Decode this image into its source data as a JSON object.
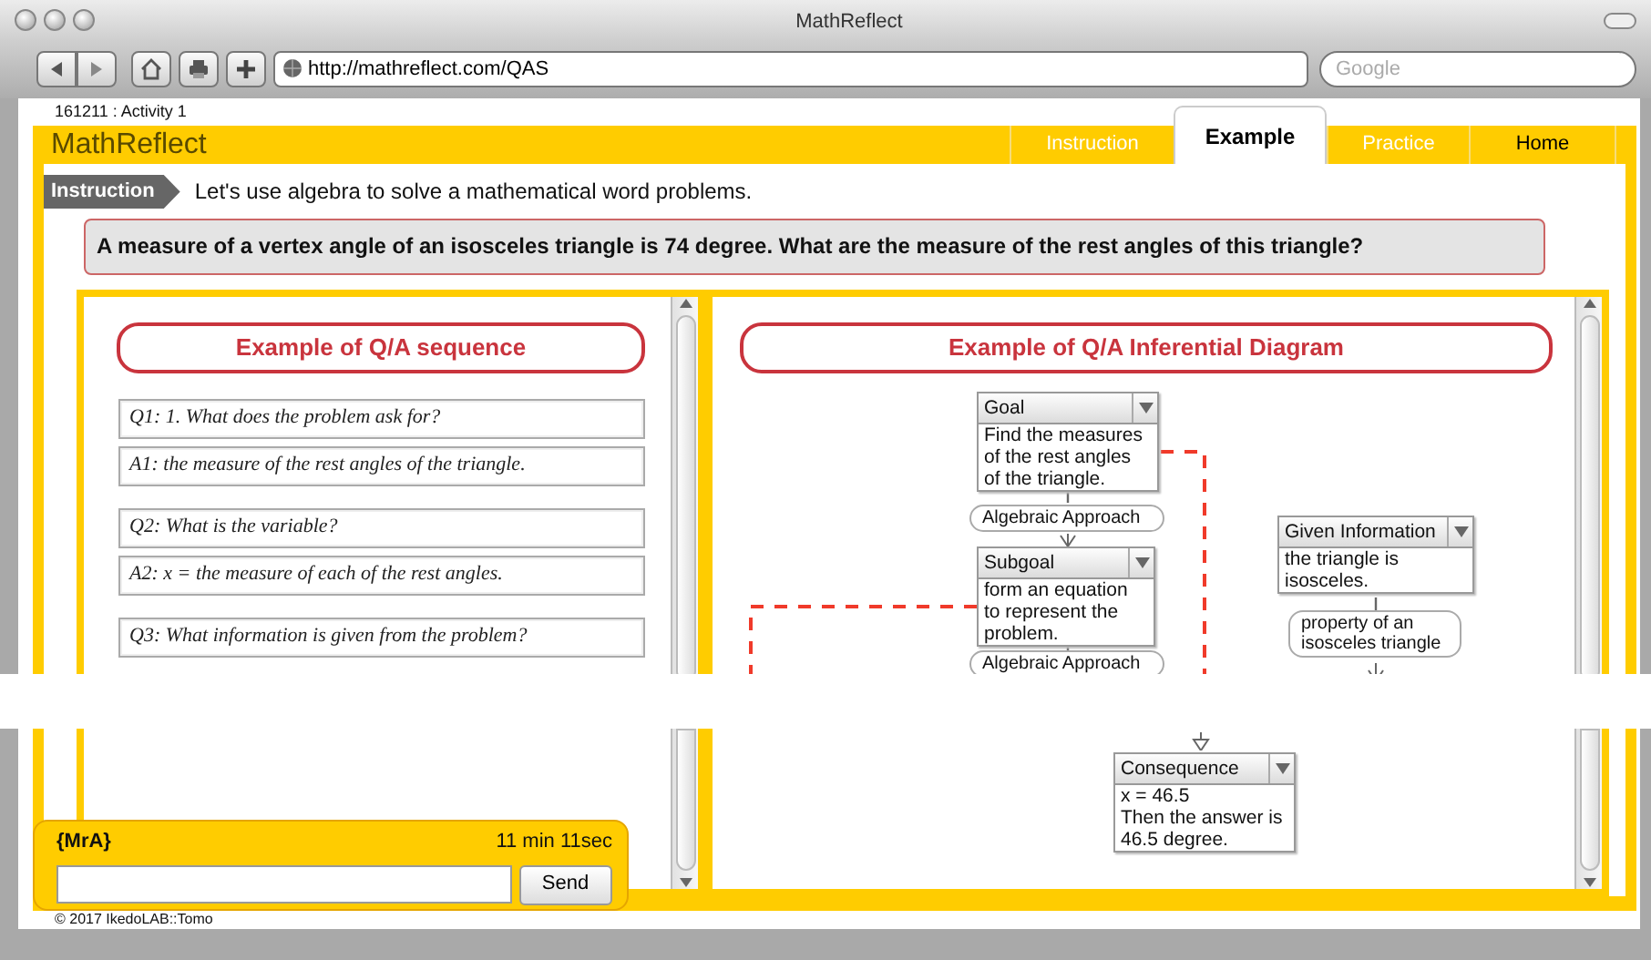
{
  "browser": {
    "title": "MathReflect",
    "url": "http://mathreflect.com/QAS",
    "search_placeholder": "Google"
  },
  "activity": "161211 : Activity 1",
  "logo": "MathReflect",
  "tabs": [
    {
      "label": "Instruction",
      "kind": "step",
      "selected": false
    },
    {
      "label": "Example",
      "kind": "step",
      "selected": true
    },
    {
      "label": "Practice",
      "kind": "step",
      "selected": false
    },
    {
      "label": "Home",
      "kind": "link",
      "selected": false
    }
  ],
  "instruction": {
    "badge": "Instruction",
    "text": "Let's use algebra to solve a mathematical word problems."
  },
  "question": "A measure of a vertex angle of an isosceles triangle is 74 degree. What are the measure of the rest angles of this triangle?",
  "qa_panel": {
    "title": "Example of Q/A sequence",
    "pairs": [
      {
        "question": "Q1: 1. What does the problem ask for?",
        "answer": "A1: the measure of the rest angles of the triangle."
      },
      {
        "question": "Q2: What is the variable?",
        "answer": "A2: x = the measure of each of the rest angles."
      },
      {
        "question": "Q3: What information is given from the problem?"
      }
    ]
  },
  "diagram": {
    "title": "Example of Q/A Inferential Diagram",
    "nodes": [
      {
        "kind": "box",
        "header": "Goal",
        "text": "Find the measures of the rest angles of the triangle."
      },
      {
        "kind": "pill",
        "text": "Algebraic Approach"
      },
      {
        "kind": "box",
        "header": "Subgoal",
        "text": "form an equation to represent the problem."
      },
      {
        "kind": "pill",
        "text": "Algebraic Approach"
      },
      {
        "kind": "box",
        "header": "Given Information",
        "text": "the triangle is isosceles."
      },
      {
        "kind": "pill",
        "text": "property of an isosceles triangle"
      },
      {
        "kind": "box",
        "header": "Consequence",
        "text": "x = 46.5\nThen the answer is\n46.5 degree."
      }
    ]
  },
  "chat": {
    "user": "{MrA}",
    "timer": "11 min 11sec",
    "button": "Send"
  },
  "footer": "© 2017 IkedoLAB::Tomo"
}
